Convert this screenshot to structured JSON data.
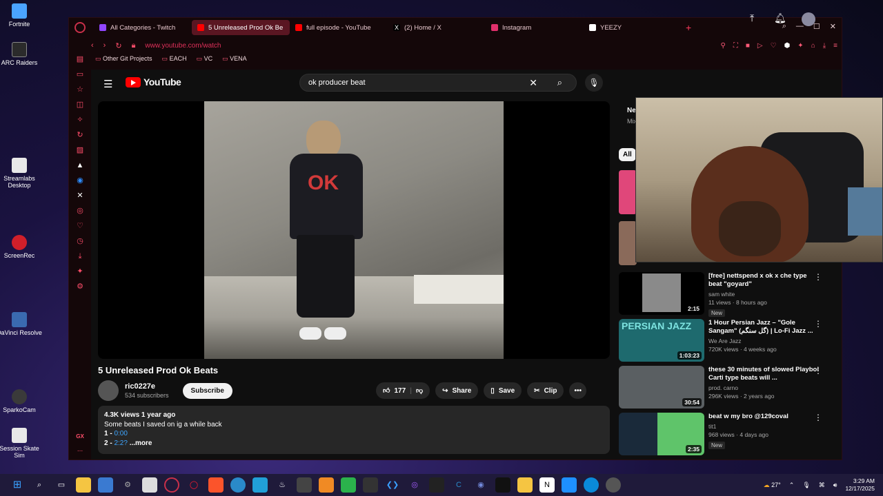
{
  "desktop": {
    "icons": [
      {
        "label": "Fortnite",
        "color": "#4aa3ff"
      },
      {
        "label": "ARC Raiders",
        "color": "#2b2b2b"
      },
      {
        "label": "Streamlabs Desktop",
        "color": "#e8e8e8"
      },
      {
        "label": "ScreenRec",
        "color": "#d01f2a"
      },
      {
        "label": "DaVinci Resolve",
        "color": "#3a6ab0"
      },
      {
        "label": "SparkoCam",
        "color": "#3a3a3a"
      },
      {
        "label": "Session Skate Sim",
        "color": "#e8e8e8"
      }
    ]
  },
  "browser": {
    "tabs": [
      {
        "label": "All Categories - Twitch",
        "fav_color": "#9146ff",
        "active": false
      },
      {
        "label": "5 Unreleased Prod Ok Be",
        "fav_color": "#ff0000",
        "active": true
      },
      {
        "label": "full episode - YouTube",
        "fav_color": "#ff0000",
        "active": false
      },
      {
        "label": "(2) Home / X",
        "fav_color": "#000000",
        "active": false
      },
      {
        "label": "Instagram",
        "fav_color": "#e1306c",
        "active": false
      },
      {
        "label": "YEEZY",
        "fav_color": "#ffffff",
        "active": false
      }
    ],
    "new_tab": "+",
    "url": "www.youtube.com/watch",
    "bookmarks": [
      "Other Git Projects",
      "EACH",
      "VC",
      "VENA"
    ],
    "sidebar_gx": "GX",
    "sidebar_more": "..."
  },
  "youtube": {
    "logo_text": "YouTube",
    "search_value": "ok producer beat",
    "video": {
      "title": "5 Unreleased Prod Ok Beats",
      "shirt_text": "OK"
    },
    "channel": {
      "name": "ric0227e",
      "subs": "534 subscribers"
    },
    "subscribe": "Subscribe",
    "likes": "177",
    "share": "Share",
    "save": "Save",
    "clip": "Clip",
    "description": {
      "stats": "4.3K views  1 year ago",
      "line": "Some beats I saved on ig a while back",
      "items": [
        {
          "num": "1 - ",
          "ts": "0:00"
        },
        {
          "num": "2 - ",
          "ts": "2:2?"
        }
      ],
      "more": "...more"
    },
    "sidebar_partial": {
      "title": "Ne",
      "sub": "Mix"
    },
    "chip_all": "All",
    "recommendations": [
      {
        "title": "[free] nettspend x ok x che type beat \"goyard\"",
        "channel": "sam white",
        "views": "11 views · 8 hours ago",
        "duration": "2:15",
        "new": "New",
        "thumb": "#2a2a2a"
      },
      {
        "title": "1 Hour Persian Jazz – \"Gole Sangam\" (گل سنگم) | Lo-Fi Jazz ...",
        "channel": "We Are Jazz",
        "views": "720K views · 4 weeks ago",
        "duration": "1:03:23",
        "new": "",
        "thumb": "#1e6a6e"
      },
      {
        "title": "these 30 minutes of slowed Playboi Carti type beats will ...",
        "channel": "prod. carno",
        "views": "296K views · 2 years ago",
        "duration": "30:54",
        "new": "",
        "thumb": "#5a5f62"
      },
      {
        "title": "beat w my bro @129coval",
        "channel": "tit1",
        "views": "968 views · 4 days ago",
        "duration": "2:35",
        "new": "New",
        "thumb": "#3f6b3a"
      }
    ],
    "thumb_thumb_text": "PERSIAN JAZZ"
  },
  "taskbar": {
    "weather": "27°",
    "time": "3:29 AM",
    "date": "12/17/2025"
  }
}
